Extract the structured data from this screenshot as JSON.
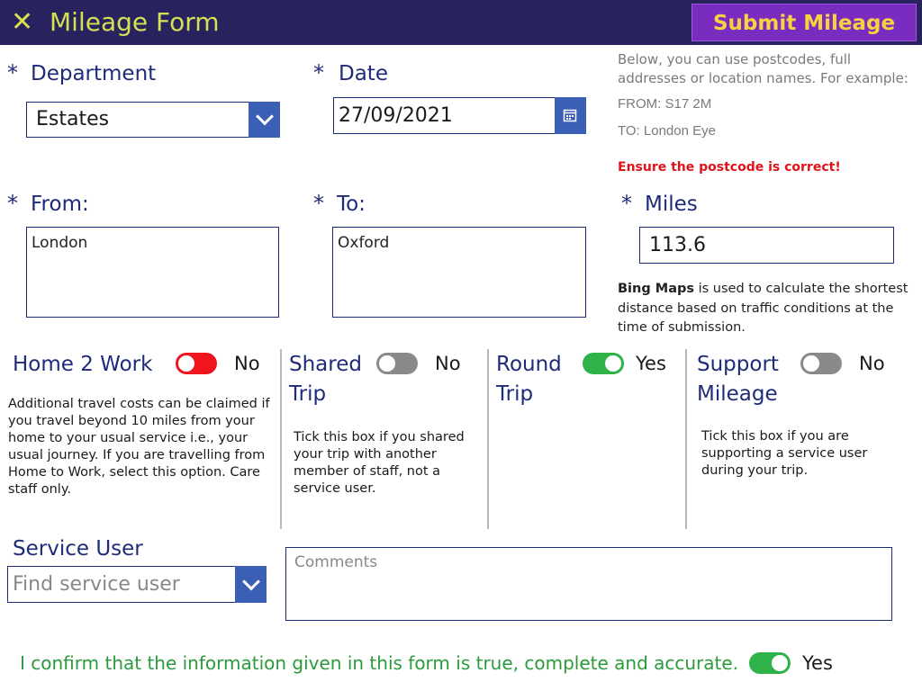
{
  "header": {
    "close_icon": "close-icon",
    "title": "Mileage Form",
    "submit_label": "Submit Mileage"
  },
  "colors": {
    "header_bg": "#28225e",
    "title_color": "#d6e053",
    "submit_bg": "#7a2cc0",
    "submit_text": "#f5d33f",
    "label_color": "#1e2b78",
    "warning": "#e0131b",
    "confirm": "#2a9b3b",
    "toggle_on": "#2fb24a",
    "toggle_alert": "#f0141f",
    "toggle_off": "#8a8a8a"
  },
  "required_mark": "*",
  "department": {
    "label": "Department",
    "value": "Estates"
  },
  "date": {
    "label": "Date",
    "value": "27/09/2021"
  },
  "help_text": {
    "intro": "Below, you can use postcodes, full addresses or location names. For example:",
    "from_example": "FROM:  S17 2M",
    "to_example": "TO:  London Eye",
    "warning": "Ensure the postcode is correct!"
  },
  "from": {
    "label": "From:",
    "value": "London"
  },
  "to": {
    "label": "To:",
    "value": "Oxford"
  },
  "miles": {
    "label": "Miles",
    "value": "113.6",
    "note_bold": "Bing Maps",
    "note_rest": " is used to calculate the shortest distance based on traffic conditions at the time of submission."
  },
  "toggles": {
    "home2work": {
      "label": "Home 2 Work",
      "state": "No",
      "description": "Additional travel costs can be claimed if you travel beyond 10 miles from your home to your usual service i.e., your usual journey. If you are travelling from Home to Work, select this option. Care staff only."
    },
    "shared_trip": {
      "label": "Shared Trip",
      "state": "No",
      "description": "Tick this box if you shared your trip with another member of staff, not a service user."
    },
    "round_trip": {
      "label": "Round Trip",
      "state": "Yes"
    },
    "support_mileage": {
      "label": "Support Mileage",
      "state": "No",
      "description": "Tick this box if you are supporting a service user during your trip."
    }
  },
  "service_user": {
    "label": "Service User",
    "placeholder": "Find service user"
  },
  "comments": {
    "placeholder": "Comments"
  },
  "confirm": {
    "text": "I confirm that the information given in this form is true, complete and accurate.",
    "state": "Yes"
  }
}
